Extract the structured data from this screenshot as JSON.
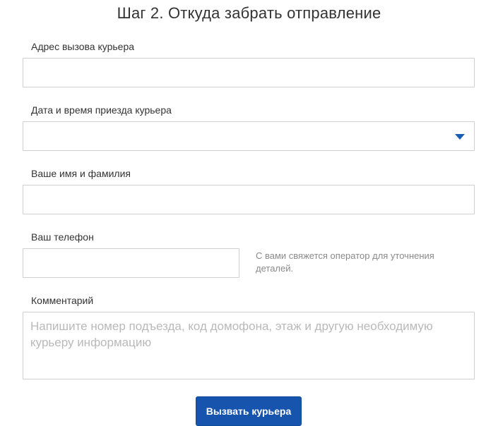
{
  "form": {
    "title": "Шаг 2. Откуда забрать отправление",
    "address": {
      "label": "Адрес вызова курьера",
      "value": "",
      "placeholder": ""
    },
    "datetime": {
      "label": "Дата и время приезда курьера",
      "selected": ""
    },
    "name": {
      "label": "Ваше имя и фамилия",
      "value": "",
      "placeholder": ""
    },
    "phone": {
      "label": "Ваш телефон",
      "value": "",
      "placeholder": "",
      "hint": "С вами свяжется оператор для уточнения деталей."
    },
    "comment": {
      "label": "Комментарий",
      "placeholder": "Напишите номер подъезда, код домофона, этаж и другую необходимую курьеру информацию"
    },
    "submit_label": "Вызвать курьера"
  },
  "colors": {
    "accent": "#1654ae",
    "dropdown_arrow": "#1a5db5",
    "border": "#cfcfcf",
    "placeholder": "#b9b9b9",
    "hint_text": "#8a8a8a"
  },
  "icons": {
    "dropdown": "chevron-down-icon"
  }
}
